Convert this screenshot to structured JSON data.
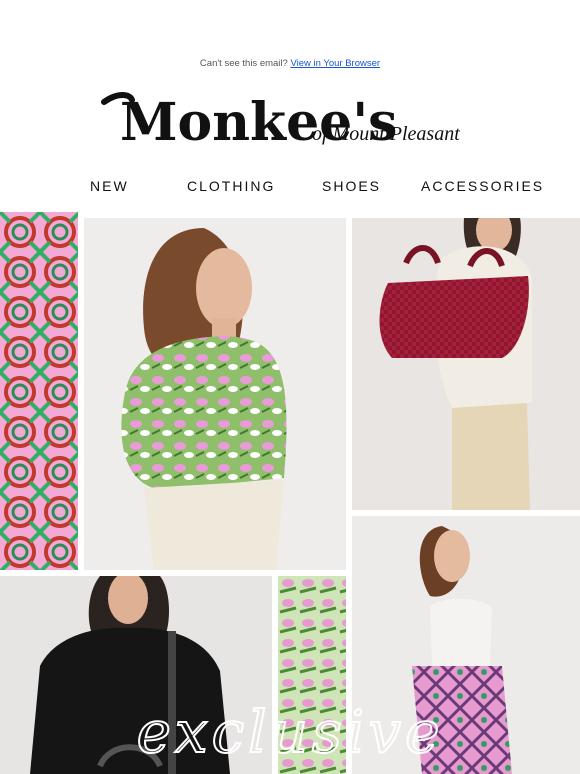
{
  "preheader": {
    "text": "Can't see this email?",
    "link": "View in Your Browser"
  },
  "brand": {
    "name": "Monkee's",
    "tagline": "of Mount Pleasant"
  },
  "nav": {
    "items": [
      "NEW",
      "CLOTHING",
      "SHOES",
      "ACCESSORIES"
    ]
  },
  "hero": {
    "script_word": "exclusive"
  },
  "colors": {
    "link": "#1a55d6",
    "pink": "#e79ad0",
    "green": "#5aa64a",
    "bag": "#8e1630"
  }
}
